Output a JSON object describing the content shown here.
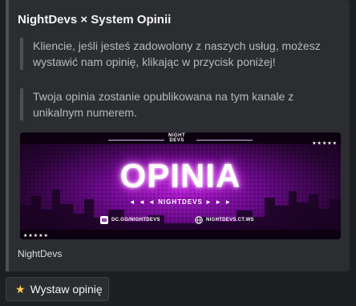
{
  "embed": {
    "title": "NightDevs × System Opinii",
    "quote1": "Kliencie, jeśli jesteś zadowolony z naszych usług, możesz wystawić nam opinię, klikając w przycisk poniżej!",
    "quote2": "Twoja opinia zostanie opublikowana na tym kanale z unikalnym numerem.",
    "footer": "NightDevs"
  },
  "banner": {
    "logo_line1": "NIGHT",
    "logo_line2": "DEVS",
    "heading": "OPINIA",
    "subheading": "◄ ◄ ◄  NIGHTDEVS  ► ► ►",
    "discord_link": "DC.GG/NIGHTDEVS",
    "website_link": "NIGHTDEVS.CT.WS",
    "stars": "★★★★★",
    "colors": {
      "accent": "#b21cd6",
      "dark": "#140219"
    }
  },
  "button": {
    "icon": "star-icon",
    "label": "Wystaw opinię"
  }
}
